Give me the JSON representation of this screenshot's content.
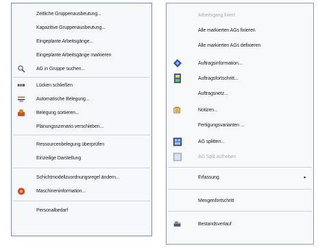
{
  "left_menu": {
    "items": [
      {
        "label": "Zeitliche Gruppenausbeutung..."
      },
      {
        "label": "Kapazitive Gruppenausbeutung..."
      },
      {
        "label": "Eingeplante Arbeitsgänge..."
      },
      {
        "label": "Eingeplante Arbeitsgänge markieren"
      },
      {
        "label": "AG in Gruppe suchen..."
      },
      {
        "label": "Lücken schließen"
      },
      {
        "label": "Automatische Belegung..."
      },
      {
        "label": "Belegung sortieren..."
      },
      {
        "label": "Planungsszenario verschieben..."
      },
      {
        "label": "Ressourcenbelegung überprüfen"
      },
      {
        "label": "Einzeilige Darstellung"
      },
      {
        "label": "Schichtmodellzuordnungsregel ändern..."
      },
      {
        "label": "Maschineninformation..."
      },
      {
        "label": "Personalbedarf"
      }
    ]
  },
  "right_menu": {
    "items": [
      {
        "label": "Arbeitsgang fixiert"
      },
      {
        "label": "Alle markierten AGs fixieren"
      },
      {
        "label": "Alle markierten AGs defixieren"
      },
      {
        "label": "Auftragsinformation..."
      },
      {
        "label": "Auftragsfortschritt..."
      },
      {
        "label": "Auftragsnetz..."
      },
      {
        "label": "Notizen..."
      },
      {
        "label": "Fertigungsvarianten ..."
      },
      {
        "label": "AG splitten..."
      },
      {
        "label": "AG Split aufheben"
      },
      {
        "label": "Erfassung"
      },
      {
        "label": "Mengenfortschritt"
      },
      {
        "label": "Bestandsverlauf"
      }
    ],
    "submenu_arrow": "▸"
  }
}
